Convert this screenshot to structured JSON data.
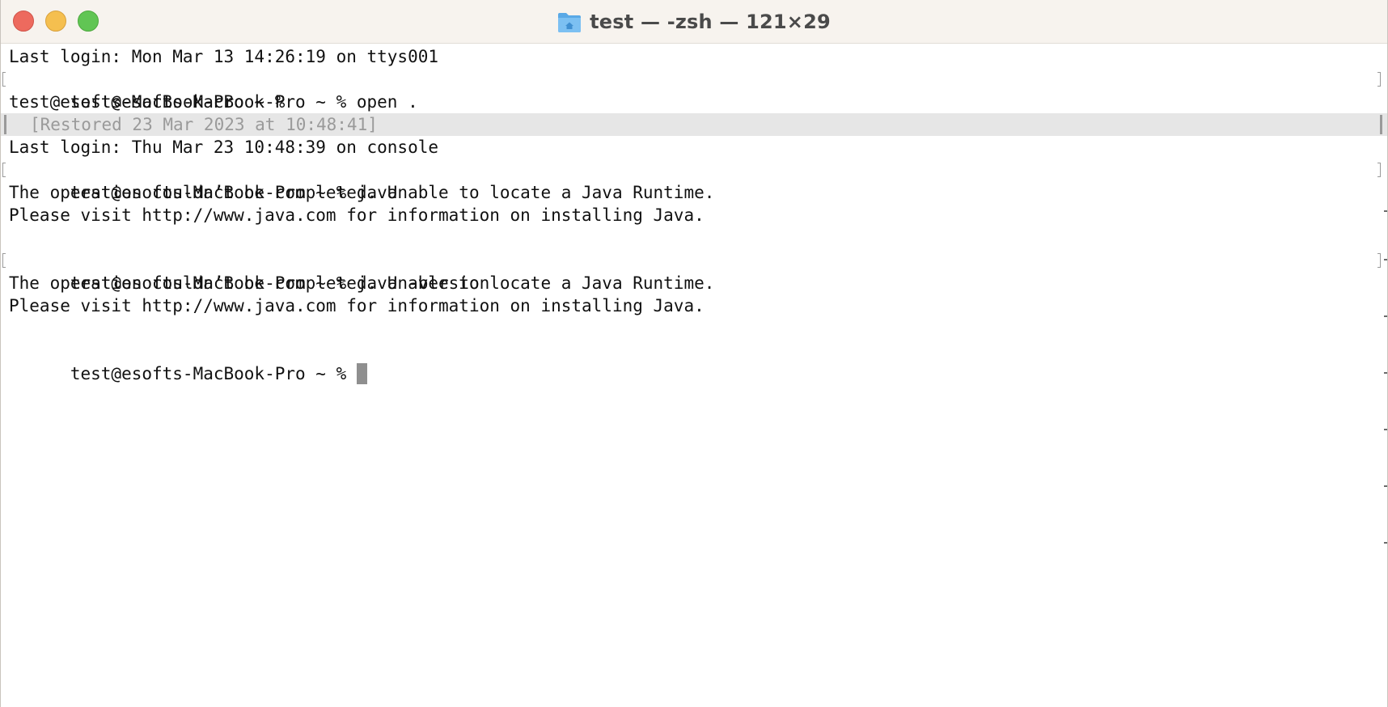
{
  "window": {
    "title": "test — -zsh — 121×29",
    "folder_icon": "home-folder-icon",
    "traffic_colors": {
      "close": "#ed6a5e",
      "minimize": "#f5bf4f",
      "zoom": "#61c554"
    }
  },
  "terminal": {
    "lines": [
      "Last login: Mon Mar 13 14:26:19 on ttys001",
      "test@esofts-MacBook-Pro ~ % open .",
      "test@esofts-MacBook-Pro ~ %",
      "[Restored 23 Mar 2023 at 10:48:41]",
      "Last login: Thu Mar 23 10:48:39 on console",
      "test@esofts-MacBook-Pro ~ % java",
      "The operation couldn’t be completed. Unable to locate a Java Runtime.",
      "Please visit http://www.java.com for information on installing Java.",
      "",
      "test@esofts-MacBook-Pro ~ % java -version",
      "The operation couldn’t be completed. Unable to locate a Java Runtime.",
      "Please visit http://www.java.com for information on installing Java.",
      "",
      "test@esofts-MacBook-Pro ~ % "
    ]
  }
}
